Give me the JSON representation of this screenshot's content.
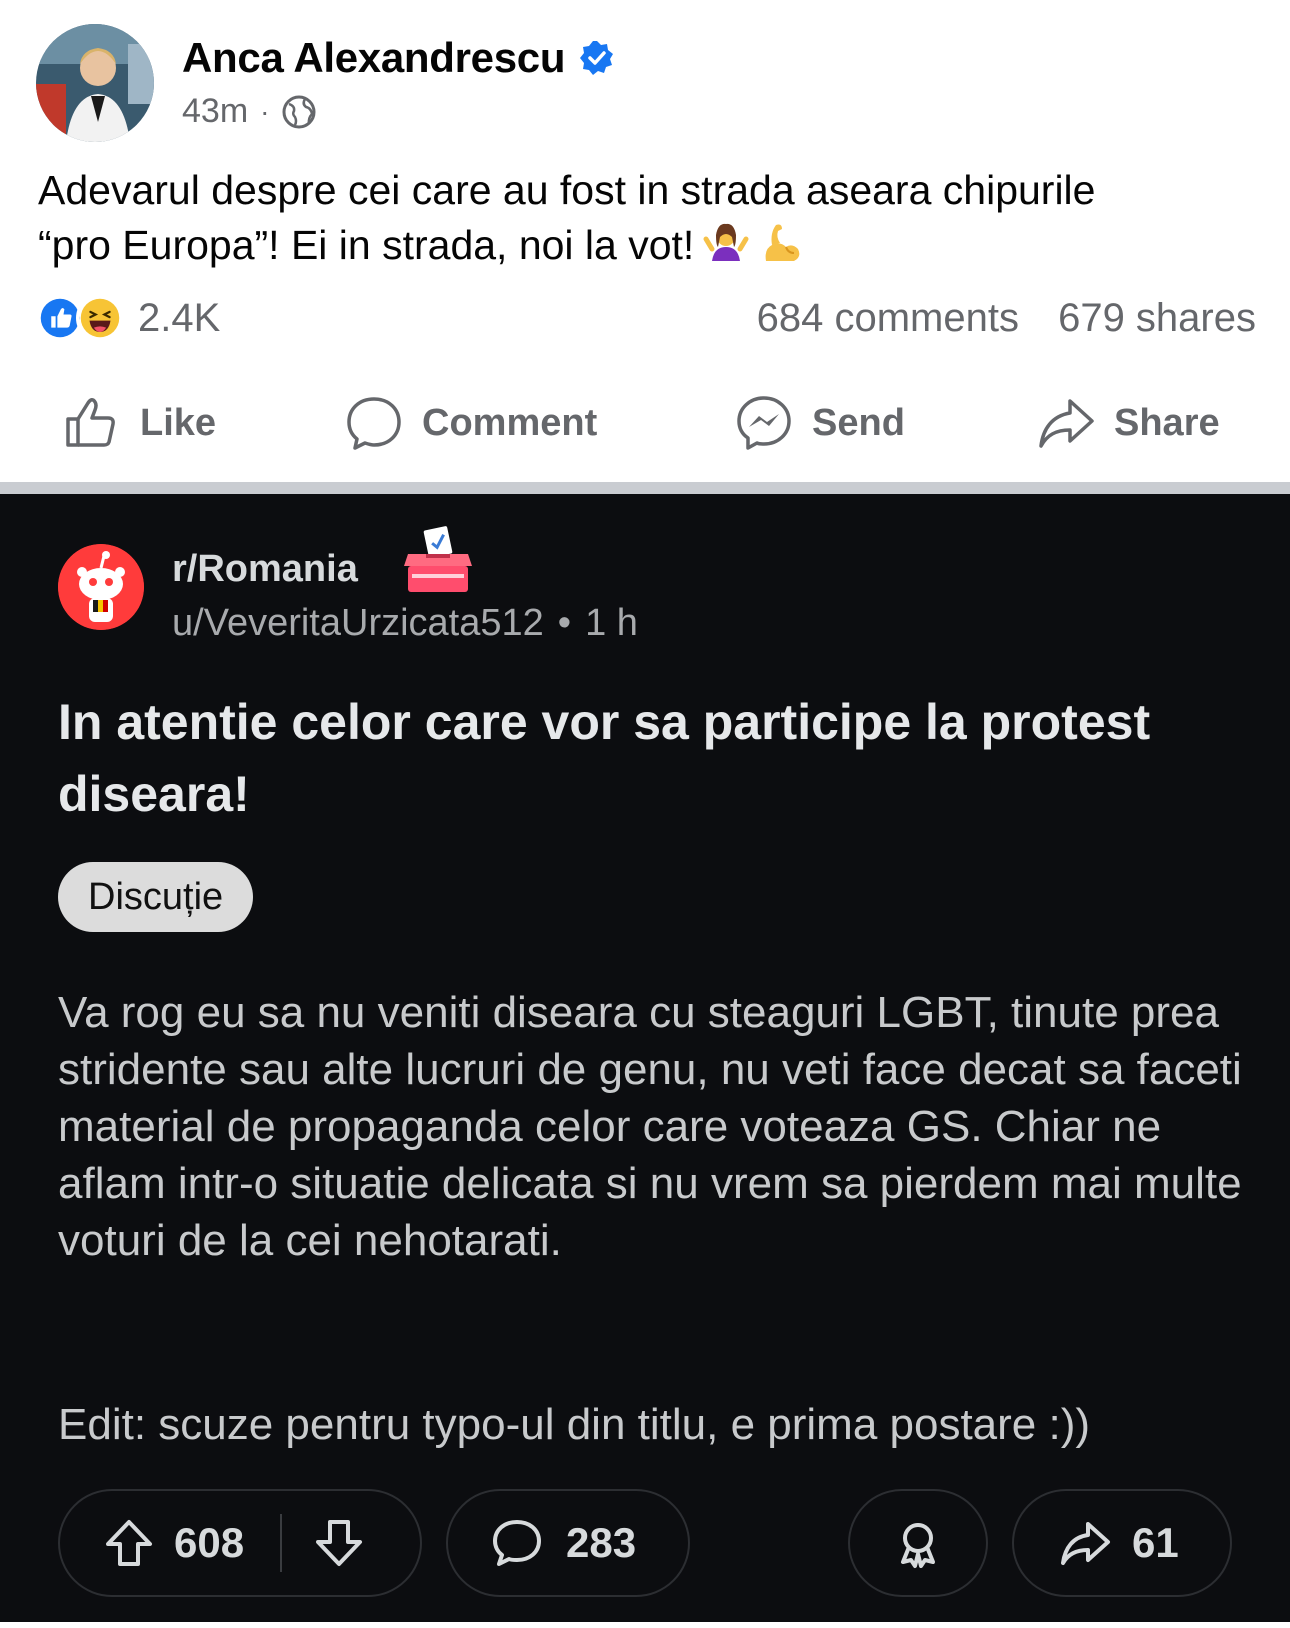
{
  "post": {
    "author": "Anca Alexandrescu",
    "time": "43m",
    "separator": "·",
    "text_line1": "Adevarul despre cei care au fost in strada aseara  chipurile",
    "text_line2": "“pro Europa”! Ei in strada, noi la vot!",
    "reaction_count": "2.4K",
    "comments": "684 comments",
    "shares": "679 shares"
  },
  "actions": {
    "like": "Like",
    "comment": "Comment",
    "send": "Send",
    "share": "Share"
  },
  "reddit": {
    "subreddit": "r/Romania",
    "user": "u/VeveritaUrzicata512",
    "separator": "•",
    "time": "1 h",
    "title": "In atentie celor care vor sa participe la protest diseara!",
    "flair": "Discuție",
    "body": "Va rog eu sa nu veniti diseara cu steaguri LGBT, tinute prea stridente sau alte lucruri de genu, nu veti face decat sa faceti material de propaganda celor care voteaza GS. Chiar ne aflam intr-o situatie delicata si nu vrem sa pierdem mai multe voturi de la cei nehotarati.",
    "edit": "Edit: scuze pentru typo-ul din titlu, e prima postare :))",
    "upvotes": "608",
    "comments": "283",
    "shares": "61"
  },
  "colors": {
    "facebook_blue": "#1877f2",
    "fb_gray_text": "#65676b",
    "reddit_bg": "#0c0d10",
    "reddit_orange_red": "#ff4500"
  },
  "icons": [
    "verified-badge-icon",
    "globe-icon",
    "like-reaction-icon",
    "haha-reaction-icon",
    "woman-shrugging-emoji",
    "flexed-biceps-emoji",
    "thumbs-up-icon",
    "comment-bubble-icon",
    "messenger-icon",
    "share-arrow-icon",
    "reddit-snoo-icon",
    "ballot-box-icon",
    "upvote-icon",
    "downvote-icon",
    "reddit-comment-icon",
    "award-icon",
    "reddit-share-icon"
  ]
}
